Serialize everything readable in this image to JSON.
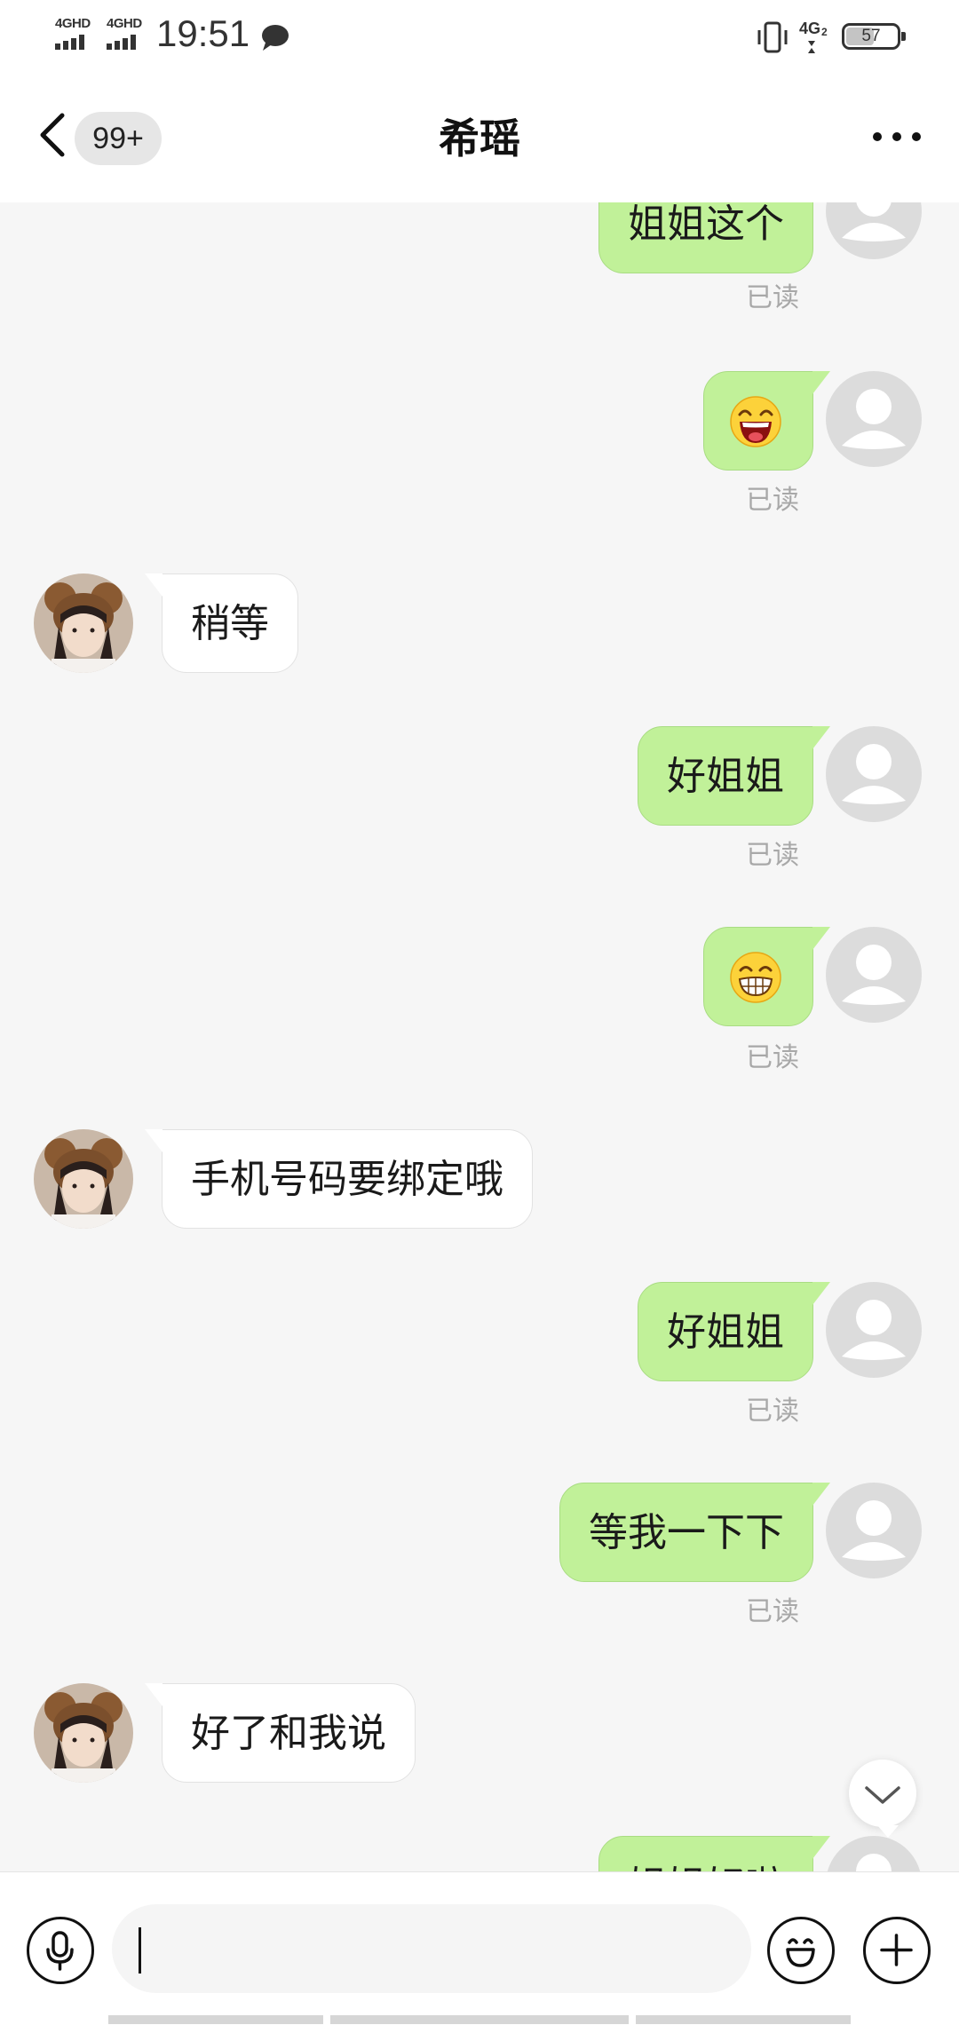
{
  "status_bar": {
    "network_1": "4GHD",
    "network_2": "4GHD",
    "time": "19:51",
    "battery": "57"
  },
  "header": {
    "unread_count": "99+",
    "title": "希瑶"
  },
  "messages": [
    {
      "sender": "me",
      "type": "text",
      "text": "姐姐这个",
      "status": "已读"
    },
    {
      "sender": "me",
      "type": "emoji",
      "emoji": "laughing-face",
      "status": "已读"
    },
    {
      "sender": "contact",
      "type": "text",
      "text": "稍等"
    },
    {
      "sender": "me",
      "type": "text",
      "text": "好姐姐",
      "status": "已读"
    },
    {
      "sender": "me",
      "type": "emoji",
      "emoji": "grinning-face",
      "status": "已读"
    },
    {
      "sender": "contact",
      "type": "text",
      "text": "手机号码要绑定哦"
    },
    {
      "sender": "me",
      "type": "text",
      "text": "好姐姐",
      "status": "已读"
    },
    {
      "sender": "me",
      "type": "text",
      "text": "等我一下下",
      "status": "已读"
    },
    {
      "sender": "contact",
      "type": "text",
      "text": "好了和我说"
    },
    {
      "sender": "me",
      "type": "text",
      "text": "姐姐好啦"
    }
  ],
  "input": {
    "value": "",
    "placeholder": ""
  },
  "colors": {
    "my_bubble": "#c1f199",
    "contact_bubble": "#ffffff",
    "background": "#f6f6f6",
    "read_label": "#a8a8a8"
  }
}
